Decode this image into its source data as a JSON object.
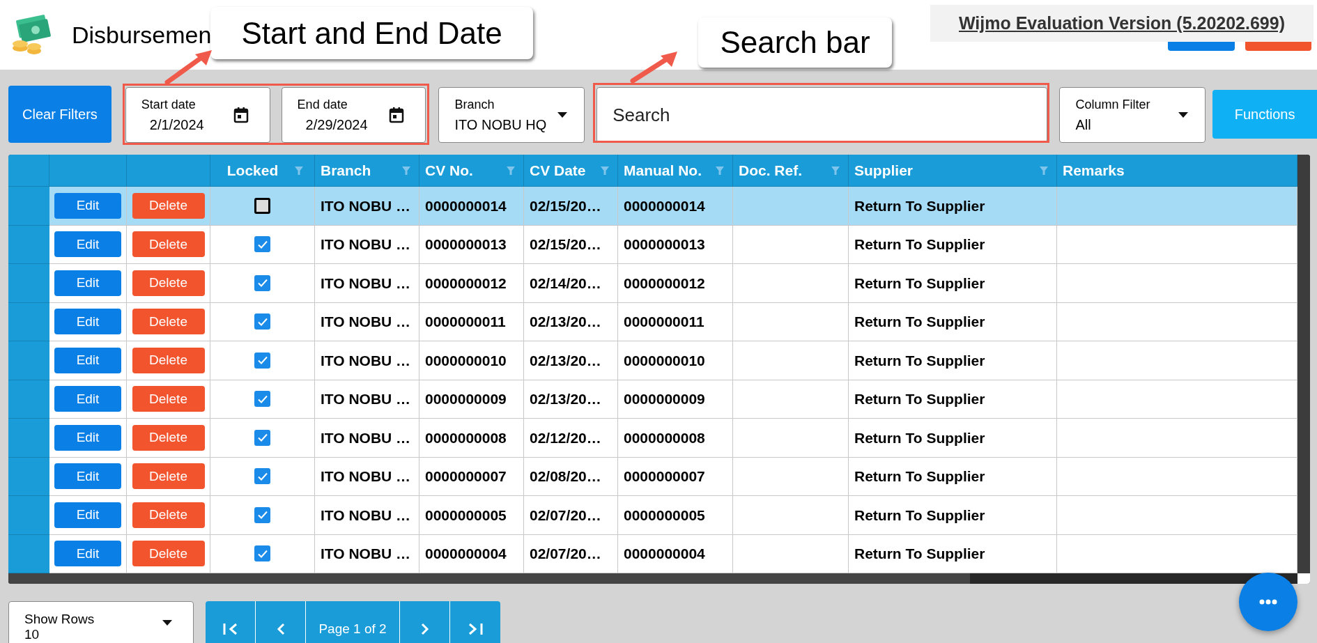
{
  "header": {
    "title": "Disbursemen",
    "banner": "Wijmo Evaluation Version (5.20202.699)"
  },
  "annotations": [
    {
      "label": "Start and End Date"
    },
    {
      "label": "Search bar"
    }
  ],
  "toolbar": {
    "clear_filters": "Clear Filters",
    "start_date": {
      "label": "Start date",
      "value": "2/1/2024"
    },
    "end_date": {
      "label": "End date",
      "value": "2/29/2024"
    },
    "branch": {
      "label": "Branch",
      "value": "ITO NOBU HQ"
    },
    "search": {
      "placeholder": "Search"
    },
    "column_filter": {
      "label": "Column Filter",
      "value": "All"
    },
    "functions": "Functions"
  },
  "table": {
    "columns": [
      {
        "label": "Locked",
        "filter": true
      },
      {
        "label": "Branch",
        "filter": true
      },
      {
        "label": "CV No.",
        "filter": true
      },
      {
        "label": "CV Date",
        "filter": true
      },
      {
        "label": "Manual No.",
        "filter": true
      },
      {
        "label": "Doc. Ref.",
        "filter": true
      },
      {
        "label": "Supplier",
        "filter": true
      },
      {
        "label": "Remarks",
        "filter": false
      }
    ],
    "rows": [
      {
        "edit": "Edit",
        "delete": "Delete",
        "locked": false,
        "selected": true,
        "branch": "ITO NOBU …",
        "cv_no": "0000000014",
        "cv_date": "02/15/20…",
        "manual_no": "0000000014",
        "supplier": "Return To Supplier"
      },
      {
        "edit": "Edit",
        "delete": "Delete",
        "locked": true,
        "selected": false,
        "branch": "ITO NOBU …",
        "cv_no": "0000000013",
        "cv_date": "02/15/20…",
        "manual_no": "0000000013",
        "supplier": "Return To Supplier"
      },
      {
        "edit": "Edit",
        "delete": "Delete",
        "locked": true,
        "selected": false,
        "branch": "ITO NOBU …",
        "cv_no": "0000000012",
        "cv_date": "02/14/20…",
        "manual_no": "0000000012",
        "supplier": "Return To Supplier"
      },
      {
        "edit": "Edit",
        "delete": "Delete",
        "locked": true,
        "selected": false,
        "branch": "ITO NOBU …",
        "cv_no": "0000000011",
        "cv_date": "02/13/20…",
        "manual_no": "0000000011",
        "supplier": "Return To Supplier"
      },
      {
        "edit": "Edit",
        "delete": "Delete",
        "locked": true,
        "selected": false,
        "branch": "ITO NOBU …",
        "cv_no": "0000000010",
        "cv_date": "02/13/20…",
        "manual_no": "0000000010",
        "supplier": "Return To Supplier"
      },
      {
        "edit": "Edit",
        "delete": "Delete",
        "locked": true,
        "selected": false,
        "branch": "ITO NOBU …",
        "cv_no": "0000000009",
        "cv_date": "02/13/20…",
        "manual_no": "0000000009",
        "supplier": "Return To Supplier"
      },
      {
        "edit": "Edit",
        "delete": "Delete",
        "locked": true,
        "selected": false,
        "branch": "ITO NOBU …",
        "cv_no": "0000000008",
        "cv_date": "02/12/20…",
        "manual_no": "0000000008",
        "supplier": "Return To Supplier"
      },
      {
        "edit": "Edit",
        "delete": "Delete",
        "locked": true,
        "selected": false,
        "branch": "ITO NOBU …",
        "cv_no": "0000000007",
        "cv_date": "02/08/20…",
        "manual_no": "0000000007",
        "supplier": "Return To Supplier"
      },
      {
        "edit": "Edit",
        "delete": "Delete",
        "locked": true,
        "selected": false,
        "branch": "ITO NOBU …",
        "cv_no": "0000000005",
        "cv_date": "02/07/20…",
        "manual_no": "0000000005",
        "supplier": "Return To Supplier"
      },
      {
        "edit": "Edit",
        "delete": "Delete",
        "locked": true,
        "selected": false,
        "branch": "ITO NOBU …",
        "cv_no": "0000000004",
        "cv_date": "02/07/20…",
        "manual_no": "0000000004",
        "supplier": "Return To Supplier"
      }
    ]
  },
  "footer": {
    "show_rows": {
      "label": "Show Rows",
      "value": "10"
    },
    "pager": {
      "page": "Page 1 of 2"
    }
  }
}
